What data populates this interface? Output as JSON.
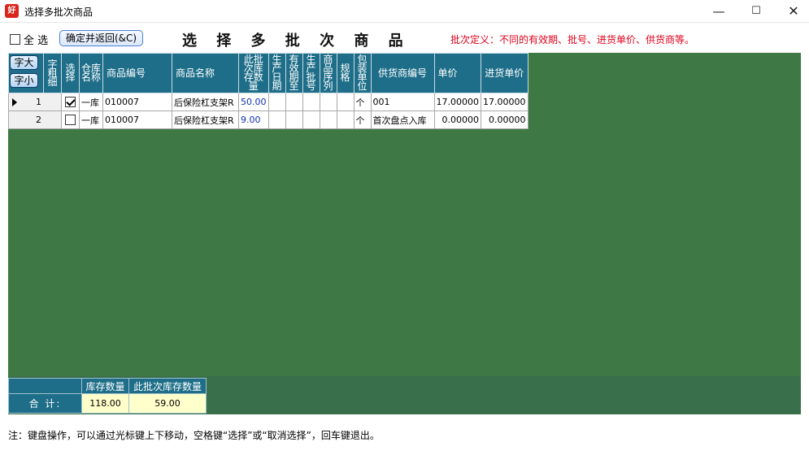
{
  "window": {
    "title": "选择多批次商品",
    "app_icon_text": "好",
    "minimize": "—",
    "maximize": "☐",
    "close": "✕"
  },
  "toolbar": {
    "select_all_label": "全 选",
    "confirm_label": "确定并返回(&C)",
    "page_title": "选 择 多 批 次 商 品",
    "batch_definition": "批次定义：不同的有效期、批号、进货单价、供货商等。"
  },
  "font_controls": {
    "big": "字大",
    "small": "字小"
  },
  "grid": {
    "corner_label": "字粗细",
    "columns": [
      "选择",
      "仓库名称",
      "商品编号",
      "商品名称",
      "此批次库存数量",
      "生产日期",
      "有效期至",
      "生产批号",
      "商品序列",
      "规格",
      "包装单位",
      "供货商编号",
      "单价",
      "进货单价"
    ],
    "rows": [
      {
        "index": "1",
        "current": true,
        "selected": true,
        "warehouse": "一库",
        "code": "010007",
        "name": "后保险杠支架R",
        "stock": "50.00",
        "prod_date": "",
        "expiry": "",
        "batch_no": "",
        "serial": "",
        "spec": "",
        "unit": "个",
        "supplier": "001",
        "price": "17.00000",
        "purchase_price": "17.00000"
      },
      {
        "index": "2",
        "current": false,
        "selected": false,
        "warehouse": "一库",
        "code": "010007",
        "name": "后保险杠支架R",
        "stock": "9.00",
        "prod_date": "",
        "expiry": "",
        "batch_no": "",
        "serial": "",
        "spec": "",
        "unit": "个",
        "supplier": "首次盘点入库",
        "price": "0.00000",
        "purchase_price": "0.00000"
      }
    ]
  },
  "summary": {
    "col_stock": "库存数量",
    "col_batch_stock": "此批次库存数量",
    "total_label": "合 计:",
    "stock_total": "118.00",
    "batch_stock_total": "59.00"
  },
  "note": "注：键盘操作，可以通过光标键上下移动，空格键“选择”或“取消选择”，回车键退出。",
  "colors": {
    "header_bg": "#1e6e89",
    "overlay_green": "#3e7844",
    "accent_red": "#e0001a",
    "summary_value_bg": "#ffffcc"
  }
}
